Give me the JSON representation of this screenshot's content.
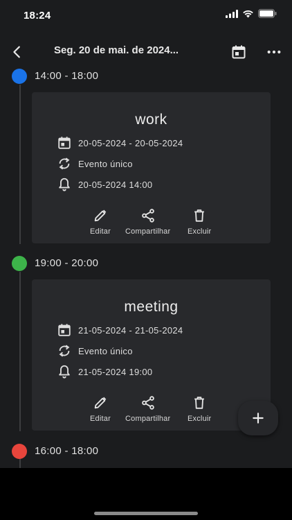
{
  "status_bar": {
    "time": "18:24"
  },
  "app_bar": {
    "title": "Seg. 20 de mai. de 2024..."
  },
  "colors": {
    "blue": "#1a73e8",
    "green": "#3db34a",
    "red": "#e8453c"
  },
  "events": [
    {
      "time_range": "14:00 - 18:00",
      "title": "work",
      "date_range": "20-05-2024 - 20-05-2024",
      "recurrence": "Evento único",
      "reminder": "20-05-2024 14:00"
    },
    {
      "time_range": "19:00 - 20:00",
      "title": "meeting",
      "date_range": "21-05-2024 - 21-05-2024",
      "recurrence": "Evento único",
      "reminder": "21-05-2024 19:00"
    },
    {
      "time_range": "16:00 - 18:00"
    }
  ],
  "actions": {
    "edit": "Editar",
    "share": "Compartilhar",
    "delete": "Excluir"
  },
  "icons": {
    "back": "chevron-left-icon",
    "calendar": "calendar-today-icon",
    "more": "more-horizontal-icon",
    "date": "calendar-icon",
    "recurrence": "repeat-icon",
    "reminder": "bell-icon",
    "edit": "pencil-icon",
    "share": "share-icon",
    "delete": "trash-icon",
    "add": "plus-icon"
  }
}
